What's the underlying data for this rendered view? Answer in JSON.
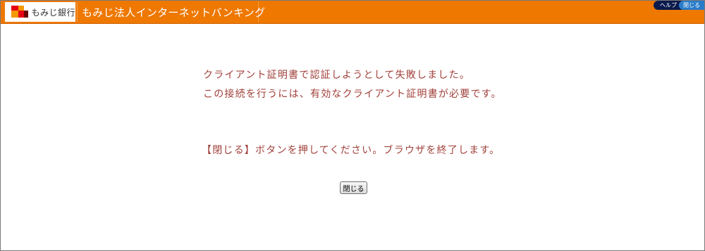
{
  "header": {
    "bank_name": "もみじ銀行",
    "title": "もみじ法人インターネットバンキング",
    "help_label": "ヘルプ",
    "close_label": "閉じる"
  },
  "main": {
    "message_line1": "クライアント証明書で認証しようとして失敗しました。",
    "message_line2": "この接続を行うには、有効なクライアント証明書が必要です。",
    "instruction": "【閉じる】ボタンを押してください。ブラウザを終了します。",
    "close_button_label": "閉じる"
  },
  "colors": {
    "header_orange": "#ee7800",
    "message_text": "#a0403a",
    "help_button": "#0a1a4c",
    "close_top_button": "#2a7cc8"
  }
}
